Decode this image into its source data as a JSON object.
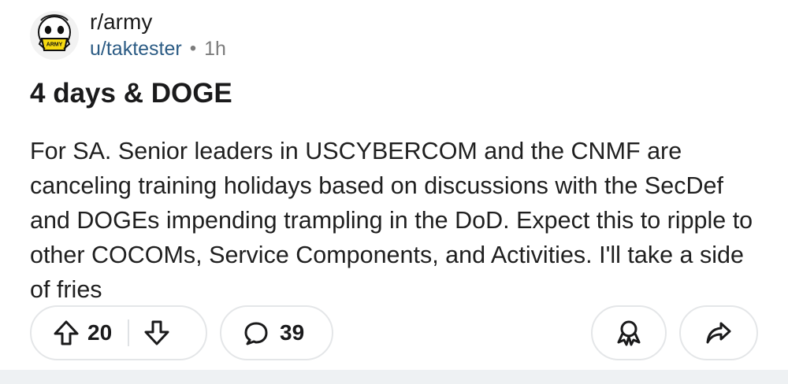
{
  "post": {
    "subreddit": "r/army",
    "author": "u/taktester",
    "separator": "•",
    "time_ago": "1h",
    "title": "4 days & DOGE",
    "body": "For SA. Senior leaders in USCYBERCOM and the CNMF are canceling training holidays based on discussions with the SecDef and DOGEs impending trampling in the DoD. Expect this to ripple to other COCOMs, Service Components, and Activities. I'll take a side of fries",
    "avatar_badge_text": "ARMY"
  },
  "actions": {
    "vote_count": "20",
    "comment_count": "39"
  },
  "colors": {
    "username": "#2b5b84",
    "meta_gray": "#7c7c7c",
    "border": "#e4e6e8",
    "avatar_badge": "#f6d90f",
    "bottom_strip": "#eef1f3"
  },
  "icons": {
    "upvote": "upvote-arrow-icon",
    "downvote": "downvote-arrow-icon",
    "comment": "comment-bubble-icon",
    "award": "award-icon",
    "share": "share-arrow-icon"
  }
}
